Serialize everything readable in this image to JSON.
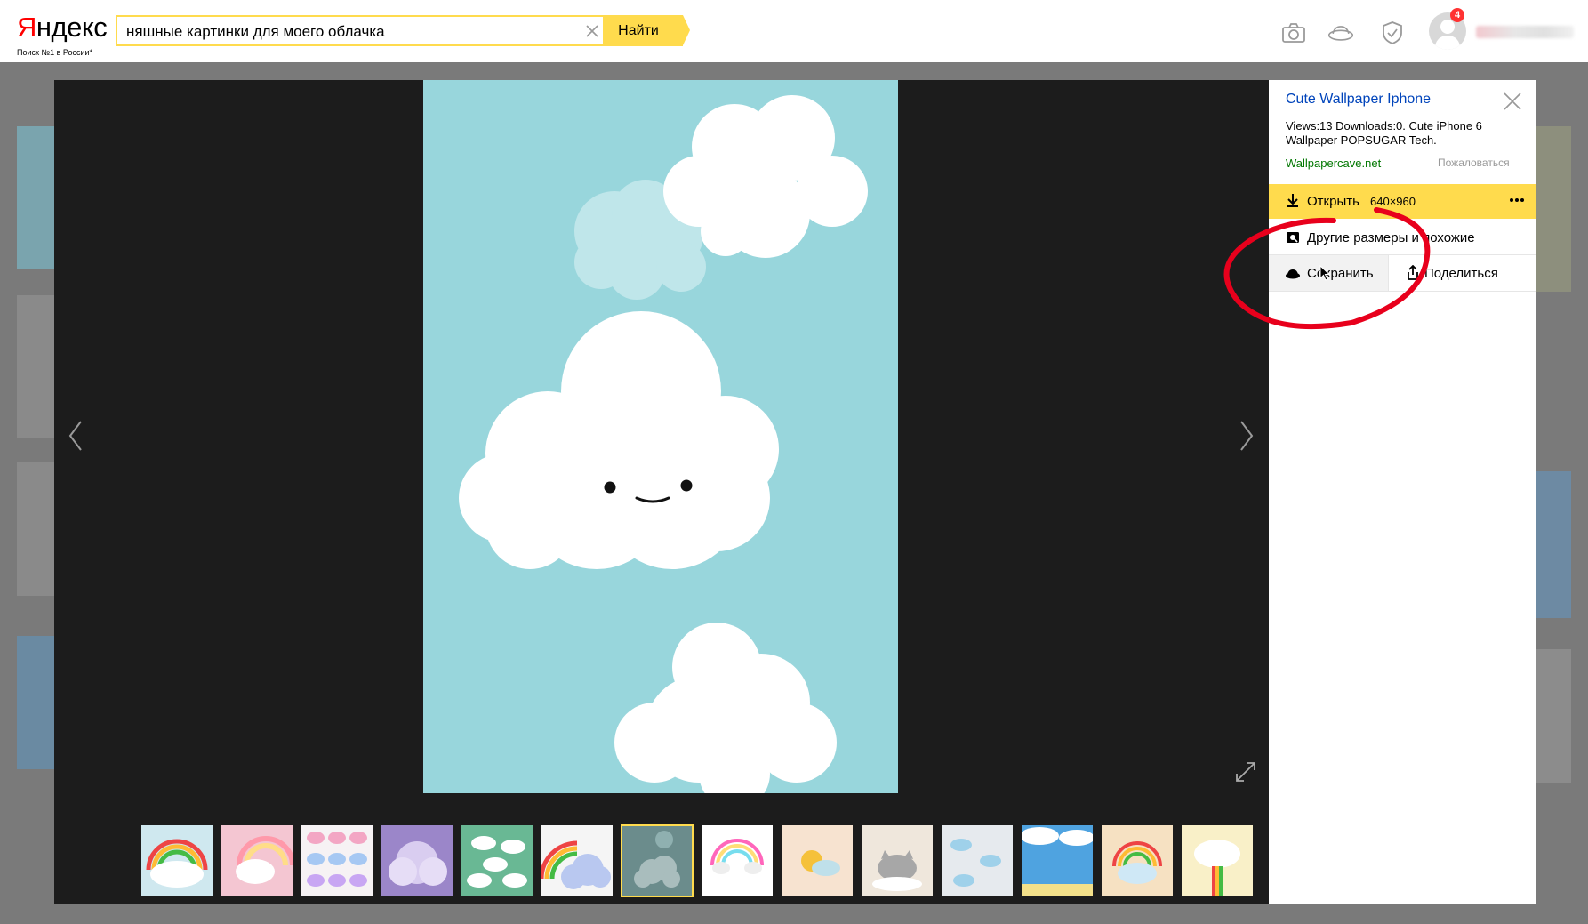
{
  "header": {
    "logo_first_letter": "Я",
    "logo_rest": "ндекс",
    "tagline": "Поиск №1 в России*",
    "search_value": "няшные картинки для моего облачка",
    "search_button": "Найти",
    "notifications_count": "4",
    "icons": [
      "camera-icon",
      "disk-icon",
      "shield-icon",
      "avatar"
    ]
  },
  "panel": {
    "title": "Cute Wallpaper Iphone",
    "description": "Views:13 Downloads:0. Cute iPhone 6 Wallpaper POPSUGAR Tech.",
    "source": "Wallpapercave.net",
    "report": "Пожаловаться",
    "open_label": "Открыть",
    "open_size": "640×960",
    "other_sizes": "Другие размеры и похожие",
    "save": "Сохранить",
    "share": "Поделиться"
  },
  "thumbnails": [
    {
      "name": "rainbow-cloud-text",
      "bg": "#cfe8ef"
    },
    {
      "name": "pink-rainbow-cloud",
      "bg": "#f4c6d2"
    },
    {
      "name": "cloud-stickers",
      "bg": "#f6f2f4"
    },
    {
      "name": "purple-cloud",
      "bg": "#9b86c9"
    },
    {
      "name": "green-clouds",
      "bg": "#69b894"
    },
    {
      "name": "rainbow-blue-cloud",
      "bg": "#f5f5f5"
    },
    {
      "name": "grey-cloud-active",
      "bg": "#6b8c8c"
    },
    {
      "name": "rainbow-rain-cloud",
      "bg": "#ffffff"
    },
    {
      "name": "sun-cloud",
      "bg": "#f7e3d0"
    },
    {
      "name": "pusheen-cloud",
      "bg": "#efe7dc"
    },
    {
      "name": "cloud-rainbows",
      "bg": "#e6eaee"
    },
    {
      "name": "sky-clouds",
      "bg": "#4fa3e0"
    },
    {
      "name": "rainbow-cloud-beige",
      "bg": "#f6e1c2"
    },
    {
      "name": "angry-cloud-rainbow",
      "bg": "#f9f0c8"
    }
  ],
  "colors": {
    "accent": "#ffdb4d",
    "link": "#0044bb",
    "source": "#007700",
    "image_bg": "#98d6dc",
    "annotation": "#e8001c"
  }
}
